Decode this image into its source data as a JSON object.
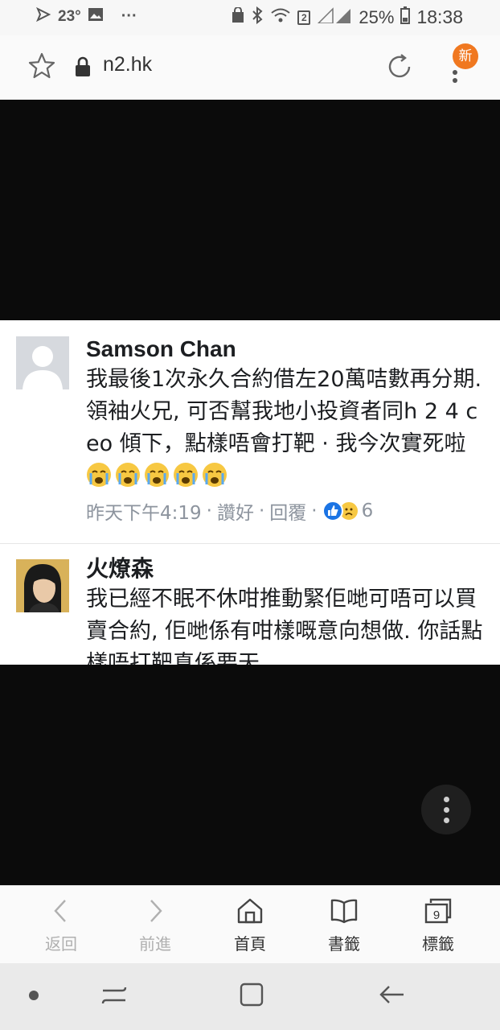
{
  "status_bar": {
    "temperature": "23°",
    "more": "···",
    "sim_badge": "2",
    "battery": "25%",
    "time": "18:38"
  },
  "url_bar": {
    "url": "n2.hk",
    "new_badge": "新"
  },
  "comments": [
    {
      "author": "Samson Chan",
      "text": "我最後1次永久合約借左20萬咭數再分期. 領袖火兄, 可否幫我地小投資者同h 2  4 ceo 傾下，點樣唔會打靶 · 我今次實死啦",
      "time": "昨天下午4:19",
      "like": "讚好",
      "reply": "回覆",
      "reaction_count": "6"
    },
    {
      "author": "火燎森",
      "text": "我已經不眠不休咁推動緊佢哋可唔可以買賣合約, 佢哋係有咁樣嘅意向想做. 你話點樣唔打靶真係要天"
    }
  ],
  "browser_nav": {
    "back": "返回",
    "forward": "前進",
    "home": "首頁",
    "bookmarks": "書籤",
    "tabs": "標籤",
    "tab_count": "9"
  },
  "colors": {
    "accent_badge": "#f07820",
    "facebook_blue": "#1b74e4",
    "meta_gray": "#8d949e"
  }
}
